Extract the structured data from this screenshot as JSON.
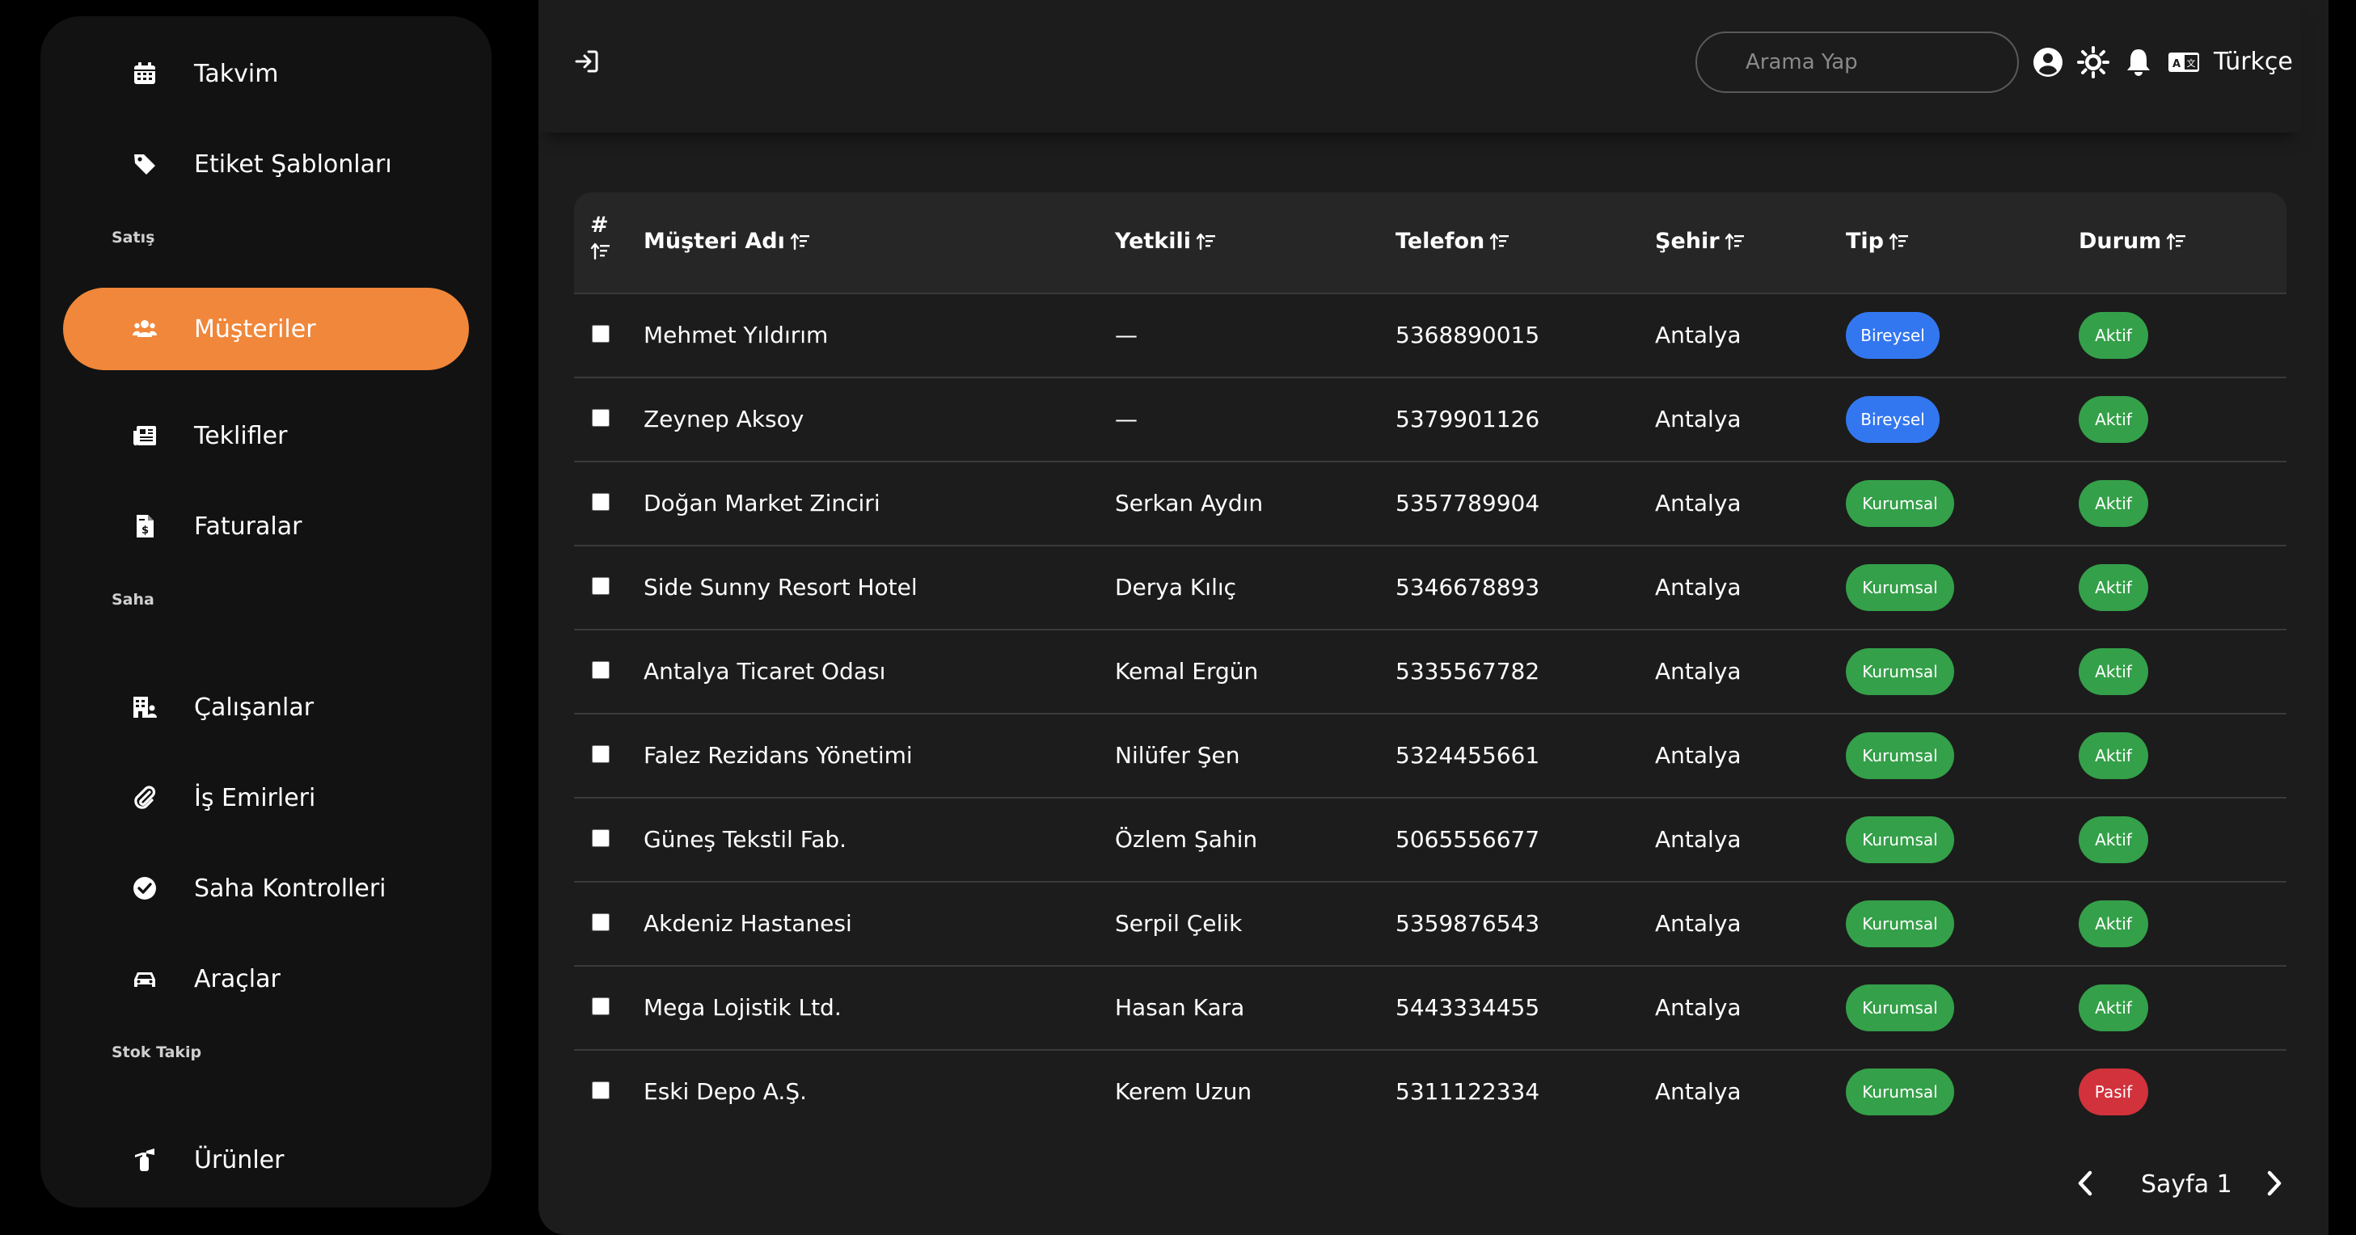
{
  "sidebar": {
    "items": [
      {
        "label": "Takvim",
        "icon": "calendar-icon"
      },
      {
        "label": "Etiket Şablonları",
        "icon": "tag-icon"
      },
      {
        "label": "Müşteriler",
        "icon": "users-icon",
        "active": true
      },
      {
        "label": "Teklifler",
        "icon": "newspaper-icon"
      },
      {
        "label": "Faturalar",
        "icon": "invoice-icon"
      },
      {
        "label": "Çalışanlar",
        "icon": "building-user-icon"
      },
      {
        "label": "İş Emirleri",
        "icon": "paperclip-icon"
      },
      {
        "label": "Saha Kontrolleri",
        "icon": "check-circle-icon"
      },
      {
        "label": "Araçlar",
        "icon": "car-icon"
      },
      {
        "label": "Ürünler",
        "icon": "fire-extinguisher-icon"
      }
    ],
    "sections": [
      "Satış",
      "Saha",
      "Stok Takip"
    ]
  },
  "topbar": {
    "search_placeholder": "Arama Yap",
    "language": "Türkçe"
  },
  "table": {
    "headers": {
      "hash": "#",
      "name": "Müşteri Adı",
      "contact": "Yetkili",
      "phone": "Telefon",
      "city": "Şehir",
      "type": "Tip",
      "status": "Durum"
    },
    "rows": [
      {
        "name": "Mehmet Yıldırım",
        "contact": "—",
        "phone": "5368890015",
        "city": "Antalya",
        "type": "Bireysel",
        "status": "Aktif"
      },
      {
        "name": "Zeynep Aksoy",
        "contact": "—",
        "phone": "5379901126",
        "city": "Antalya",
        "type": "Bireysel",
        "status": "Aktif"
      },
      {
        "name": "Doğan Market Zinciri",
        "contact": "Serkan Aydın",
        "phone": "5357789904",
        "city": "Antalya",
        "type": "Kurumsal",
        "status": "Aktif"
      },
      {
        "name": "Side Sunny Resort Hotel",
        "contact": "Derya Kılıç",
        "phone": "5346678893",
        "city": "Antalya",
        "type": "Kurumsal",
        "status": "Aktif"
      },
      {
        "name": "Antalya Ticaret Odası",
        "contact": "Kemal Ergün",
        "phone": "5335567782",
        "city": "Antalya",
        "type": "Kurumsal",
        "status": "Aktif"
      },
      {
        "name": "Falez Rezidans Yönetimi",
        "contact": "Nilüfer Şen",
        "phone": "5324455661",
        "city": "Antalya",
        "type": "Kurumsal",
        "status": "Aktif"
      },
      {
        "name": "Güneş Tekstil Fab.",
        "contact": "Özlem Şahin",
        "phone": "5065556677",
        "city": "Antalya",
        "type": "Kurumsal",
        "status": "Aktif"
      },
      {
        "name": "Akdeniz Hastanesi",
        "contact": "Serpil Çelik",
        "phone": "5359876543",
        "city": "Antalya",
        "type": "Kurumsal",
        "status": "Aktif"
      },
      {
        "name": "Mega Lojistik Ltd.",
        "contact": "Hasan Kara",
        "phone": "5443334455",
        "city": "Antalya",
        "type": "Kurumsal",
        "status": "Aktif"
      },
      {
        "name": "Eski Depo A.Ş.",
        "contact": "Kerem Uzun",
        "phone": "5311122334",
        "city": "Antalya",
        "type": "Kurumsal",
        "status": "Pasif"
      }
    ]
  },
  "pagination": {
    "label": "Sayfa 1"
  },
  "colors": {
    "accent": "#f0873a",
    "bireysel": "#3377f0",
    "kurumsal": "#34a049",
    "aktif": "#34a049",
    "pasif": "#d1323c"
  }
}
